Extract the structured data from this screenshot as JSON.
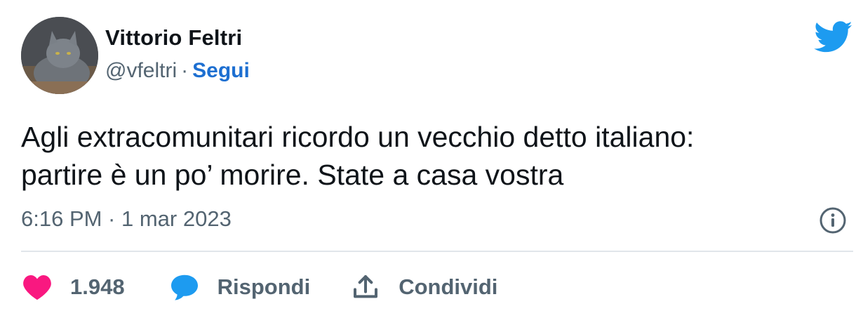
{
  "author": {
    "name": "Vittorio Feltri",
    "handle": "@vfeltri",
    "separator": "·",
    "follow_label": "Segui"
  },
  "tweet": {
    "lines": [
      "Agli extracomunitari ricordo un vecchio detto italiano:",
      "partire è un po’ morire. State a casa vostra"
    ],
    "timestamp": "6:16 PM · 1 mar 2023"
  },
  "actions": {
    "likes_count": "1.948",
    "reply_label": "Rispondi",
    "share_label": "Condividi"
  },
  "icons": {
    "brand": "twitter-bird-icon",
    "info": "info-icon",
    "like": "heart-icon",
    "reply": "speech-bubble-icon",
    "share": "share-upload-icon"
  },
  "colors": {
    "brand_blue": "#1d9bf0",
    "follow_link": "#1d6fd1",
    "like_pink": "#f91880",
    "secondary_text": "#536471"
  }
}
